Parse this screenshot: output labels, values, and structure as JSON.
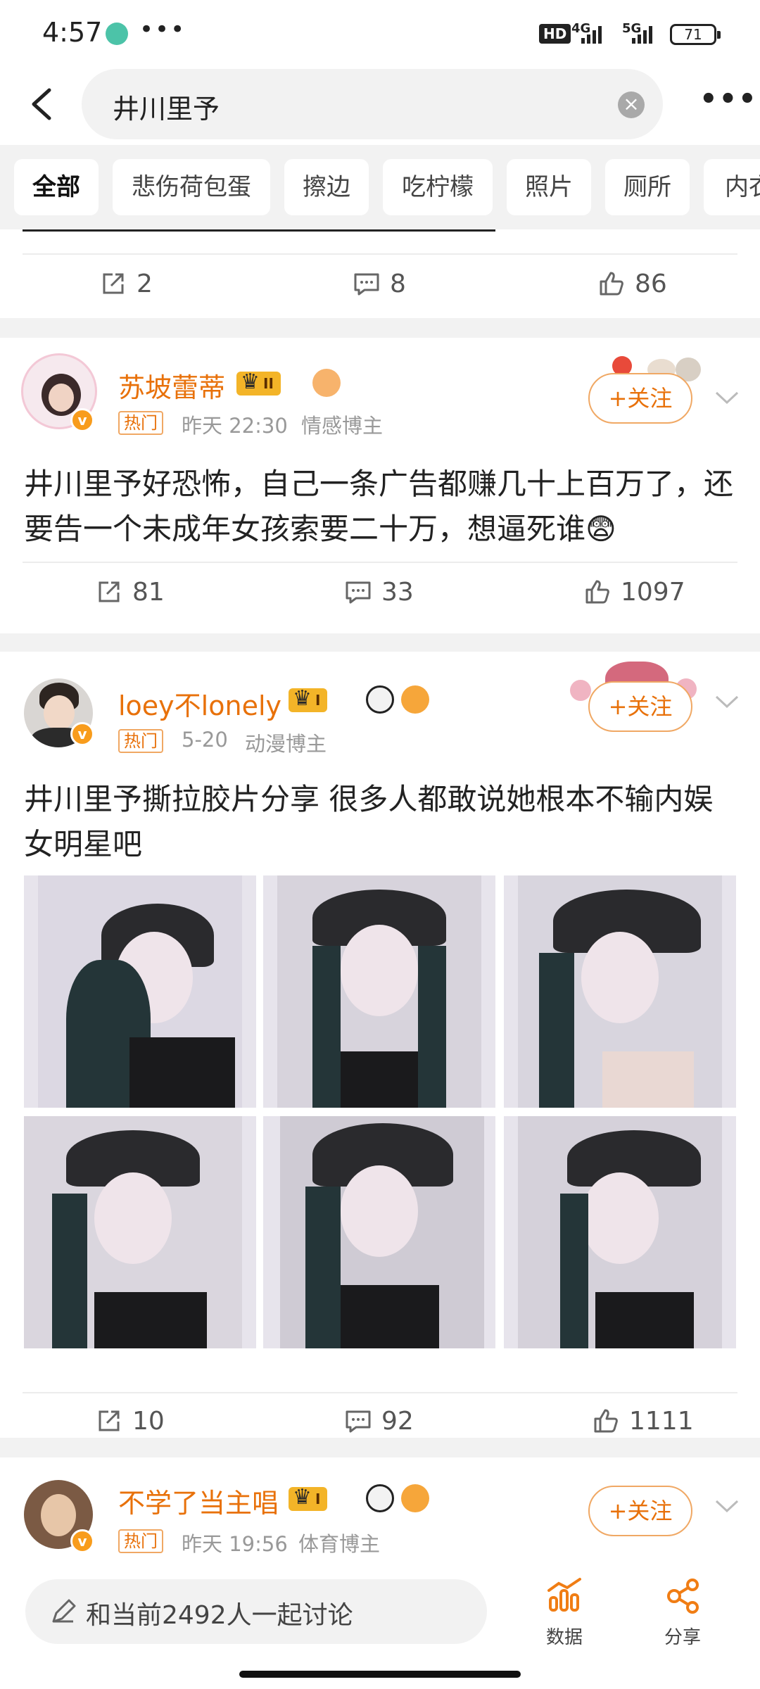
{
  "status_bar": {
    "time": "4:57",
    "battery": "71",
    "network_a": "4G",
    "network_b": "5G",
    "hd": "HD"
  },
  "search": {
    "query": "井川里予"
  },
  "tabs": [
    "全部",
    "悲伤荷包蛋",
    "擦边",
    "吃柠檬",
    "照片",
    "厕所",
    "内衣"
  ],
  "posts": [
    {
      "shares": "2",
      "comments": "8",
      "likes": "86"
    },
    {
      "user": "苏坡蕾蒂",
      "level": "II",
      "hot": "热门",
      "time": "昨天 22:30",
      "category": "情感博主",
      "follow": "+关注",
      "text": "井川里予好恐怖，自己一条广告都赚几十上百万了，还要告一个未成年女孩索要二十万，想逼死谁😨",
      "shares": "81",
      "comments": "33",
      "likes": "1097"
    },
    {
      "user": "loey不lonely",
      "level": "I",
      "hot": "热门",
      "time": "5-20",
      "category": "动漫博主",
      "follow": "+关注",
      "text": "井川里予撕拉胶片分享 很多人都敢说她根本不输内娱女明星吧",
      "shares": "10",
      "comments": "92",
      "likes": "1111"
    },
    {
      "user": "不学了当主唱",
      "level": "I",
      "hot": "热门",
      "time": "昨天 19:56",
      "category": "体育博主",
      "follow": "+关注"
    }
  ],
  "bottom_bar": {
    "discuss": "和当前2492人一起讨论",
    "data_label": "数据",
    "share_label": "分享"
  },
  "colors": {
    "accent": "#e8710a",
    "background": "#f2f2f2"
  }
}
